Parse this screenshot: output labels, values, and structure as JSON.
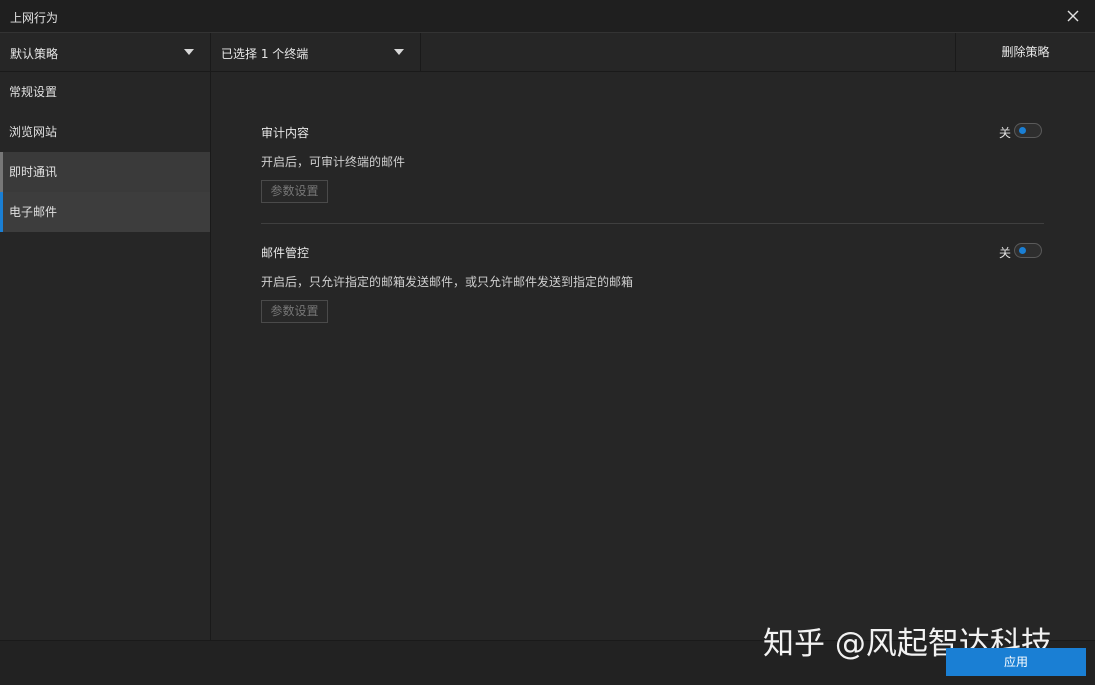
{
  "window": {
    "title": "上网行为"
  },
  "toolbar": {
    "policy_select": "默认策略",
    "terminal_select": "已选择 1 个终端",
    "delete_label": "删除策略"
  },
  "sidebar": {
    "items": [
      {
        "label": "常规设置"
      },
      {
        "label": "浏览网站"
      },
      {
        "label": "即时通讯"
      },
      {
        "label": "电子邮件"
      }
    ]
  },
  "sections": [
    {
      "title": "审计内容",
      "toggle_label": "关",
      "description": "开启后，可审计终端的邮件",
      "param_label": "参数设置"
    },
    {
      "title": "邮件管控",
      "toggle_label": "关",
      "description": "开启后，只允许指定的邮箱发送邮件，或只允许邮件发送到指定的邮箱",
      "param_label": "参数设置"
    }
  ],
  "footer": {
    "apply_label": "应用"
  },
  "watermark": "知乎 @风起智达科技",
  "colors": {
    "accent": "#1a7fd4",
    "background": "#262626"
  },
  "icons": {
    "close": "close-icon",
    "caret": "caret-down-icon"
  }
}
